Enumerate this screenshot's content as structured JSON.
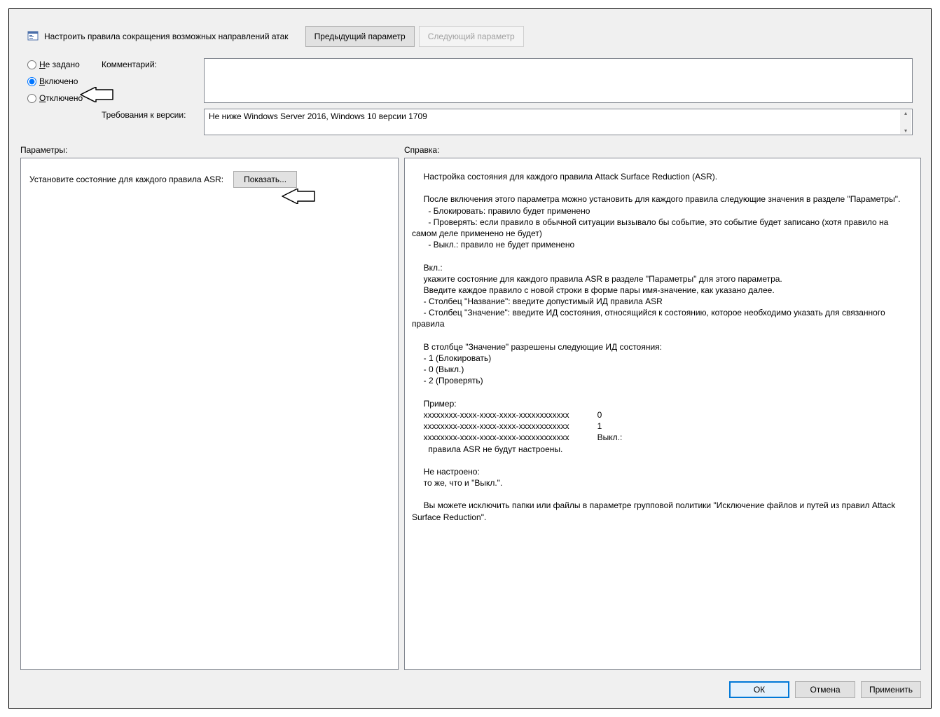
{
  "header": {
    "title": "Настроить правила сокращения возможных направлений атак",
    "prev_label": "Предыдущий параметр",
    "next_label": "Следующий параметр"
  },
  "state": {
    "not_configured_label": "Не задано",
    "enabled_label": "Включено",
    "disabled_label": "Отключено",
    "selected": "enabled"
  },
  "comment": {
    "label": "Комментарий:",
    "value": ""
  },
  "requirements": {
    "label": "Требования к версии:",
    "value": "Не ниже Windows Server 2016, Windows 10 версии 1709"
  },
  "sections": {
    "options_label": "Параметры:",
    "help_label": "Справка:"
  },
  "options": {
    "row_label": "Установите состояние для каждого правила ASR:",
    "show_button_label": "Показать..."
  },
  "help_text": "     Настройка состояния для каждого правила Attack Surface Reduction (ASR).\n\n     После включения этого параметра можно установить для каждого правила следующие значения в разделе \"Параметры\".\n       - Блокировать: правило будет применено\n       - Проверять: если правило в обычной ситуации вызывало бы событие, это событие будет записано (хотя правило на самом деле применено не будет)\n       - Выкл.: правило не будет применено\n\n     Вкл.:\n     укажите состояние для каждого правила ASR в разделе \"Параметры\" для этого параметра.\n     Введите каждое правило с новой строки в форме пары имя-значение, как указано далее.\n     - Столбец \"Название\": введите допустимый ИД правила ASR\n     - Столбец \"Значение\": введите ИД состояния, относящийся к состоянию, которое необходимо указать для связанного правила\n\n     В столбце \"Значение\" разрешены следующие ИД состояния:\n     - 1 (Блокировать)\n     - 0 (Выкл.)\n     - 2 (Проверять)\n\n     Пример:\n     xxxxxxxx-xxxx-xxxx-xxxx-xxxxxxxxxxxx            0\n     xxxxxxxx-xxxx-xxxx-xxxx-xxxxxxxxxxxx            1\n     xxxxxxxx-xxxx-xxxx-xxxx-xxxxxxxxxxxx            Выкл.:\n       правила ASR не будут настроены.\n\n     Не настроено:\n     то же, что и \"Выкл.\".\n\n     Вы можете исключить папки или файлы в параметре групповой политики \"Исключение файлов и путей из правил Attack Surface Reduction\".",
  "footer": {
    "ok": "ОК",
    "cancel": "Отмена",
    "apply": "Применить"
  }
}
